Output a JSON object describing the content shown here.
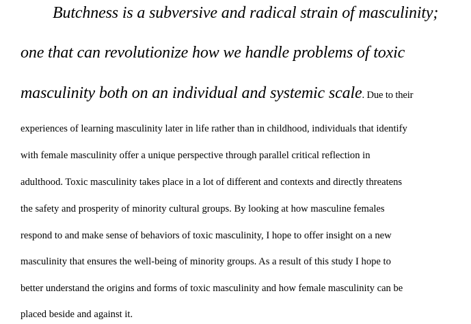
{
  "document": {
    "thesis": [
      "Butchness is a subversive and radical strain of masculinity;",
      "one that can revolutionize how we handle problems of toxic",
      "masculinity both on an individual and systemic scale"
    ],
    "thesis_tail": ". Due to their",
    "body_lines": [
      "experiences of learning masculinity later in life rather than in childhood, individuals that identify",
      "with female masculinity offer a unique perspective through parallel critical reflection in",
      "adulthood. Toxic masculinity takes place in a lot of different and contexts and directly threatens",
      "the safety and prosperity of minority cultural groups. By looking at how masculine females",
      "respond to and make sense of behaviors of toxic masculinity, I hope to offer insight on a new",
      "masculinity that ensures the well-being of minority groups. As a result of this study I hope to",
      "better understand the origins and forms of toxic masculinity and how female masculinity can be",
      "placed beside and against it."
    ]
  }
}
